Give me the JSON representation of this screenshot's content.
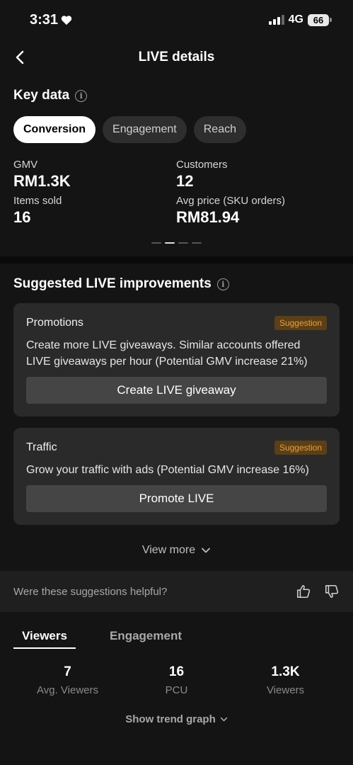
{
  "status": {
    "time": "3:31",
    "network": "4G",
    "battery": "66"
  },
  "nav": {
    "title": "LIVE details"
  },
  "key_data": {
    "heading": "Key data",
    "tabs": [
      "Conversion",
      "Engagement",
      "Reach"
    ],
    "active_tab": "Conversion",
    "metrics": [
      {
        "label": "GMV",
        "value": "RM1.3K"
      },
      {
        "label": "Customers",
        "value": "12"
      },
      {
        "label": "Items sold",
        "value": "16"
      },
      {
        "label": "Avg price (SKU orders)",
        "value": "RM81.94"
      }
    ],
    "page_indicator": {
      "pages": 4,
      "active": 2
    }
  },
  "improvements": {
    "heading": "Suggested LIVE improvements",
    "cards": [
      {
        "title": "Promotions",
        "badge": "Suggestion",
        "text": "Create more LIVE giveaways. Similar accounts offered LIVE giveaways per hour (Potential GMV increase 21%)",
        "button": "Create LIVE giveaway"
      },
      {
        "title": "Traffic",
        "badge": "Suggestion",
        "text": "Grow your traffic with ads (Potential GMV increase 16%)",
        "button": "Promote LIVE"
      }
    ],
    "view_more": "View more"
  },
  "feedback": {
    "question": "Were these suggestions helpful?"
  },
  "viewers": {
    "tabs": [
      "Viewers",
      "Engagement"
    ],
    "active_tab": "Viewers",
    "stats": [
      {
        "value": "7",
        "label": "Avg. Viewers"
      },
      {
        "value": "16",
        "label": "PCU"
      },
      {
        "value": "1.3K",
        "label": "Viewers"
      }
    ],
    "trend_label": "Show trend graph"
  }
}
